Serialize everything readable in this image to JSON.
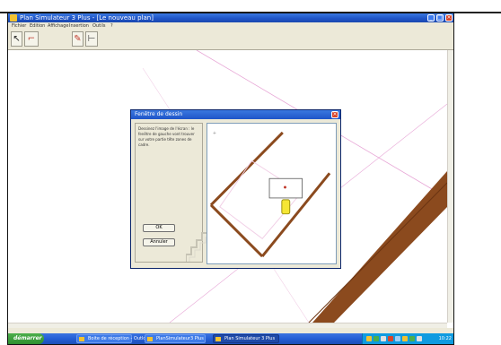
{
  "window": {
    "title": "Plan Simulateur 3 Plus - [Le nouveau plan]",
    "minimize": "_",
    "maximize": "□",
    "close": "×"
  },
  "menu": {
    "items": [
      "Fichier",
      "Edition",
      "Affichage",
      "Insertion",
      "Outils",
      "?"
    ]
  },
  "dialog": {
    "title": "Fenêtre de dessin",
    "description": "Dessinez l'image de l'écran : le fenêtre de gauche vont trouver sur votre partie tête zones de cadre.",
    "ok_label": "OK",
    "cancel_label": "Annuler",
    "close": "×"
  },
  "taskbar": {
    "start_label": "démarrer",
    "tasks": [
      "Boite de réception - Outlook",
      "PlanSimulateur3 Plus",
      "Plan Simulateur 3 Plus"
    ],
    "clock": "10:22"
  },
  "colors": {
    "wall_brown": "#8b4a1e",
    "guide_pink": "#e7a6d6",
    "xp_blue": "#245ed6",
    "marker_yellow": "#f5e635"
  }
}
